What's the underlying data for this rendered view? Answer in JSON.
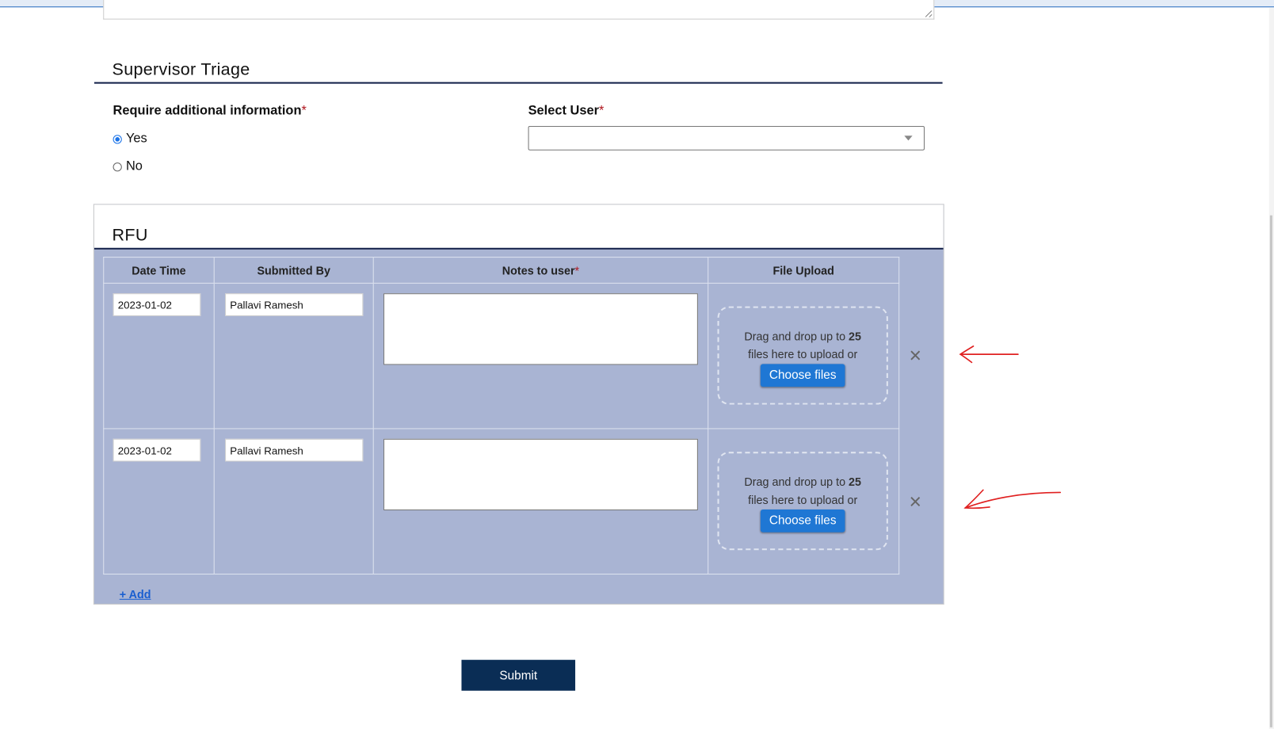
{
  "supervisor_triage": {
    "title": "Supervisor Triage",
    "require_info_label": "Require additional information",
    "required_mark": "*",
    "options": [
      {
        "label": "Yes",
        "selected": true
      },
      {
        "label": "No",
        "selected": false
      }
    ],
    "select_user_label": "Select User",
    "select_user_value": ""
  },
  "rfu": {
    "title": "RFU",
    "columns": [
      "Date Time",
      "Submitted By",
      "Notes to user",
      "File Upload"
    ],
    "rows": [
      {
        "date": "2023-01-02",
        "submitted_by": "Pallavi Ramesh",
        "notes": ""
      },
      {
        "date": "2023-01-02",
        "submitted_by": "Pallavi Ramesh",
        "notes": ""
      }
    ],
    "drop_text_1": "Drag and drop up to ",
    "drop_count": "25",
    "drop_text_2": "files here to upload or",
    "choose_files": "Choose files",
    "remove_icon": "×",
    "add_label": "+ Add"
  },
  "submit_label": "Submit",
  "colors": {
    "navy": "#14214a",
    "panel": "#a9b4d3",
    "accent": "#1f77d4",
    "submit": "#0a2d55",
    "annotation": "#e02020"
  }
}
